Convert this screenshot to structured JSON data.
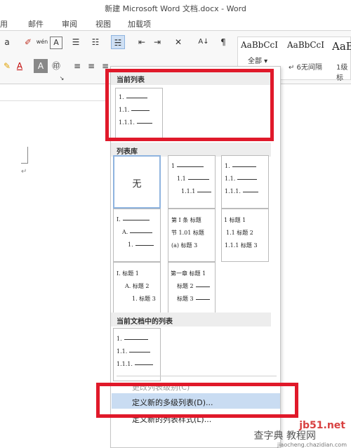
{
  "window": {
    "title": "新建 Microsoft Word 文档.docx - Word"
  },
  "tabs": [
    "用",
    "邮件",
    "审阅",
    "视图",
    "加载项"
  ],
  "ribbon": {
    "font_partial": "a",
    "clear_format": "wén",
    "font_color_letter": "A",
    "highlight_letter": "A",
    "char_box": "A",
    "sort_label": "A↓",
    "styles": [
      {
        "preview": "AaBbCcI",
        "name": ""
      },
      {
        "preview": "AaBbCcI",
        "name": "↵ 6无间隔"
      },
      {
        "preview": "AaB",
        "name": "1级标"
      }
    ],
    "all_label": "全部 ▾"
  },
  "panel": {
    "current_list_header": "当前列表",
    "library_header": "列表库",
    "doc_lists_header": "当前文档中的列表",
    "none_label": "无",
    "current_list": [
      "1.",
      "1.1.",
      "1.1.1."
    ],
    "library": [
      {
        "lines": [
          "1",
          "1.1",
          "1.1.1"
        ]
      },
      {
        "lines": [
          "1.",
          "1.1.",
          "1.1.1."
        ]
      },
      {
        "lines": [
          "I.",
          "A.",
          "1."
        ]
      },
      {
        "lines": [
          "第 I 条 标题",
          "节 1.01 标题",
          "(a) 标题 3"
        ]
      },
      {
        "lines": [
          "1 标题 1",
          "1.1 标题 2",
          "1.1.1 标题 3"
        ]
      },
      {
        "lines": [
          "I. 标题 1",
          "A. 标题 2",
          "1. 标题 3"
        ]
      },
      {
        "lines": [
          "第一章 标题 1",
          "标题 2",
          "标题 3"
        ]
      }
    ],
    "doc_list": [
      "1.",
      "1.1.",
      "1.1.1."
    ],
    "menu": {
      "change_level": "更改列表级别(C)",
      "define_new_multilevel": "定义新的多级列表(D)...",
      "define_new_style": "定义新的列表样式(L)..."
    }
  },
  "watermark": {
    "line1": "jb51.net",
    "line2": "查字典 教程网",
    "line3": "jiaocheng.chazidian.com"
  },
  "colors": {
    "highlight_red": "#e0192a",
    "menu_hover": "#c9dcf2",
    "selected_border": "#8fb4df"
  }
}
